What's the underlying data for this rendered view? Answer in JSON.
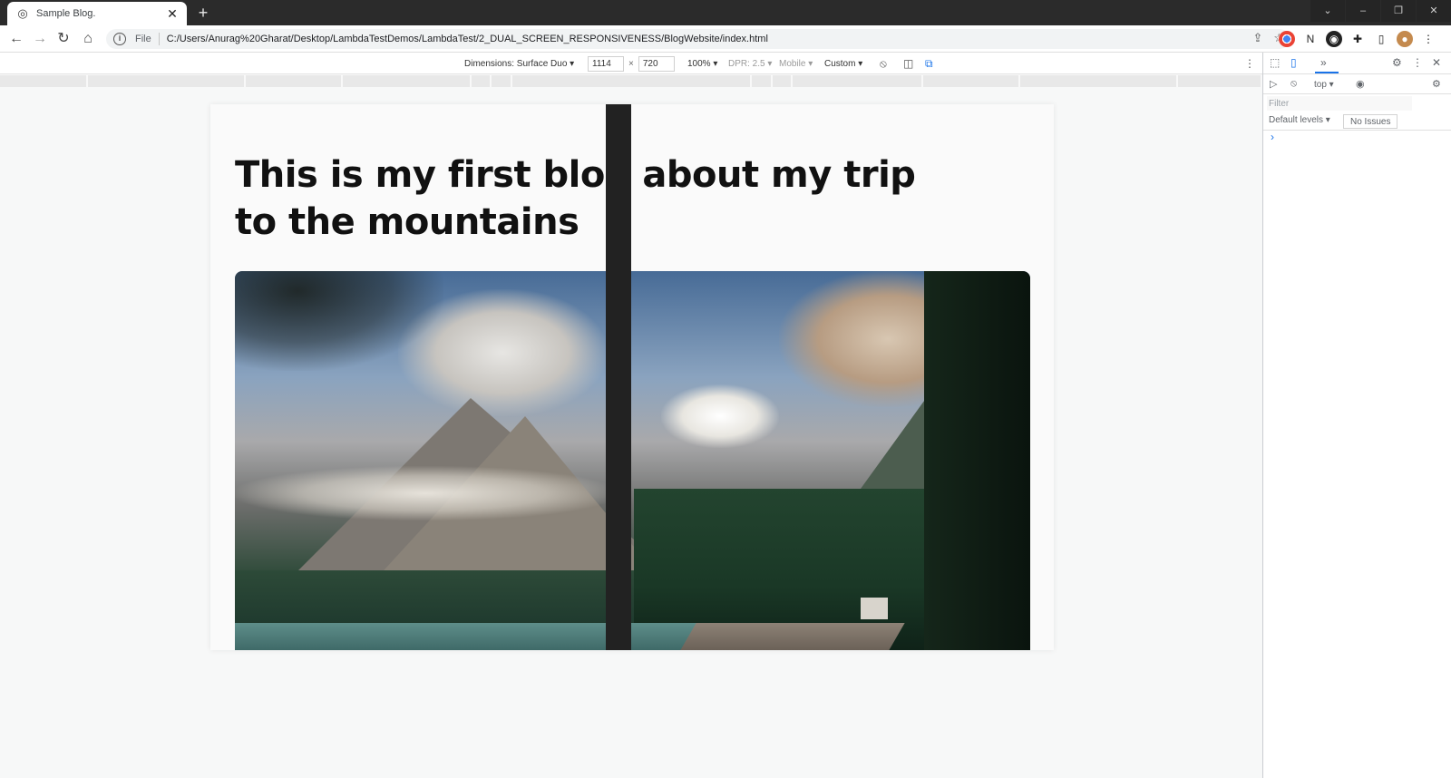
{
  "browser": {
    "tab": {
      "title": "Sample Blog.",
      "favicon": "globe-icon",
      "close": "✕"
    },
    "new_tab": "+",
    "window_controls": [
      "⌄",
      "–",
      "❐",
      "✕"
    ],
    "nav": {
      "back": "←",
      "forward": "→",
      "reload": "↻",
      "home": "⌂"
    },
    "address": {
      "scheme": "File",
      "url": "C:/Users/Anurag%20Gharat/Desktop/LambdaTestDemos/LambdaTest/2_DUAL_SCREEN_RESPONSIVENESS/BlogWebsite/index.html"
    }
  },
  "device_toolbar": {
    "dimensions": "Dimensions: Surface Duo ▾",
    "width": "1114",
    "times": "×",
    "height": "720",
    "zoom": "100% ▾",
    "dpr": "DPR: 2.5 ▾",
    "mode": "Mobile ▾",
    "throttle": "Custom ▾"
  },
  "page": {
    "title": "This is my first blog about my trip to the mountains",
    "hero_alt": "mountain-lake-photo"
  },
  "devtools": {
    "more": "»",
    "context": "top ▾",
    "filter_placeholder": "Filter",
    "levels": "Default levels ▾",
    "issues": "No Issues",
    "prompt": "›"
  }
}
